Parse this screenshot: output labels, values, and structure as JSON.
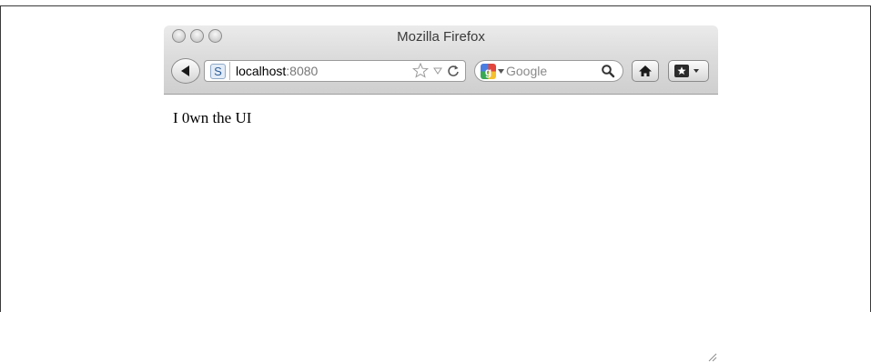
{
  "window": {
    "title": "Mozilla Firefox"
  },
  "navbar": {
    "site_badge": "S",
    "url_host": "localhost",
    "url_port": ":8080",
    "search_placeholder": "Google"
  },
  "icons": [
    "close-icon",
    "minimize-icon",
    "zoom-icon",
    "back-arrow-icon",
    "site-identity-icon",
    "bookmark-star-icon",
    "history-dropdown-icon",
    "reload-icon",
    "google-logo-icon",
    "search-engine-dropdown-icon",
    "magnifier-icon",
    "home-icon",
    "bookmarks-menu-icon",
    "resize-grip-icon"
  ],
  "page": {
    "text": "I 0wn the UI"
  }
}
